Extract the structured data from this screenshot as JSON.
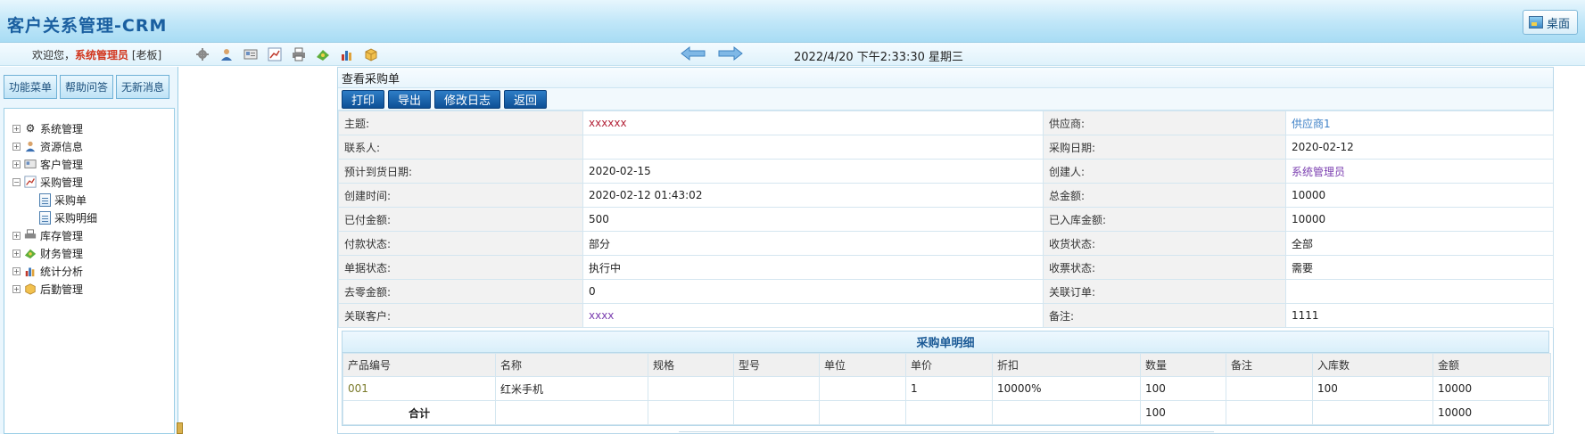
{
  "header": {
    "app_title": "客户关系管理-CRM",
    "desktop_label": "桌面"
  },
  "toolbar": {
    "welcome_prefix": "欢迎您，",
    "user_name": "系统管理员",
    "user_role": "[老板]",
    "icons": [
      "gear-icon",
      "user-icon",
      "card-icon",
      "chart-icon",
      "printer-icon",
      "money-icon",
      "bar-chart-icon",
      "box-icon"
    ],
    "datetime": "2022/4/20 下午2:33:30 星期三"
  },
  "left_panel": {
    "tabs": [
      "功能菜单",
      "帮助问答",
      "无新消息"
    ],
    "tree": [
      {
        "label": "系统管理",
        "expander": "+"
      },
      {
        "label": "资源信息",
        "expander": "+"
      },
      {
        "label": "客户管理",
        "expander": "+"
      },
      {
        "label": "采购管理",
        "expander": "−"
      },
      {
        "label": "采购单",
        "child": true
      },
      {
        "label": "采购明细",
        "child": true
      },
      {
        "label": "库存管理",
        "expander": "+"
      },
      {
        "label": "财务管理",
        "expander": "+"
      },
      {
        "label": "统计分析",
        "expander": "+"
      },
      {
        "label": "后勤管理",
        "expander": "+"
      }
    ]
  },
  "main": {
    "section_title": "查看采购单",
    "buttons": {
      "print": "打印",
      "export": "导出",
      "edit_log": "修改日志",
      "back": "返回"
    },
    "info_rows": [
      {
        "l1": "主题:",
        "v1": "xxxxxx",
        "l2": "供应商:",
        "v2": "供应商1"
      },
      {
        "l1": "联系人:",
        "v1": "",
        "l2": "采购日期:",
        "v2": "2020-02-12"
      },
      {
        "l1": "预计到货日期:",
        "v1": "2020-02-15",
        "l2": "创建人:",
        "v2": "系统管理员"
      },
      {
        "l1": "创建时间:",
        "v1": "2020-02-12 01:43:02",
        "l2": "总金额:",
        "v2": "10000"
      },
      {
        "l1": "已付金额:",
        "v1": "500",
        "l2": "已入库金额:",
        "v2": "10000"
      },
      {
        "l1": "付款状态:",
        "v1": "部分",
        "l2": "收货状态:",
        "v2": "全部"
      },
      {
        "l1": "单据状态:",
        "v1": "执行中",
        "l2": "收票状态:",
        "v2": "需要"
      },
      {
        "l1": "去零金额:",
        "v1": "0",
        "l2": "关联订单:",
        "v2": ""
      },
      {
        "l1": "关联客户:",
        "v1": "xxxx",
        "l2": "备注:",
        "v2": "1111"
      }
    ],
    "detail": {
      "title": "采购单明细",
      "columns": [
        "产品编号",
        "名称",
        "规格",
        "型号",
        "单位",
        "单价",
        "折扣",
        "数量",
        "备注",
        "入库数",
        "金额"
      ],
      "rows": [
        [
          "001",
          "红米手机",
          "",
          "",
          "",
          "1",
          "10000%",
          "100",
          "",
          "100",
          "10000"
        ]
      ],
      "total": {
        "label": "合计",
        "quantity": "100",
        "amount": "10000"
      }
    }
  },
  "colors": {
    "accent": "#1a5fa0",
    "button": "#0d4f95",
    "user_highlight": "#d2371f"
  }
}
